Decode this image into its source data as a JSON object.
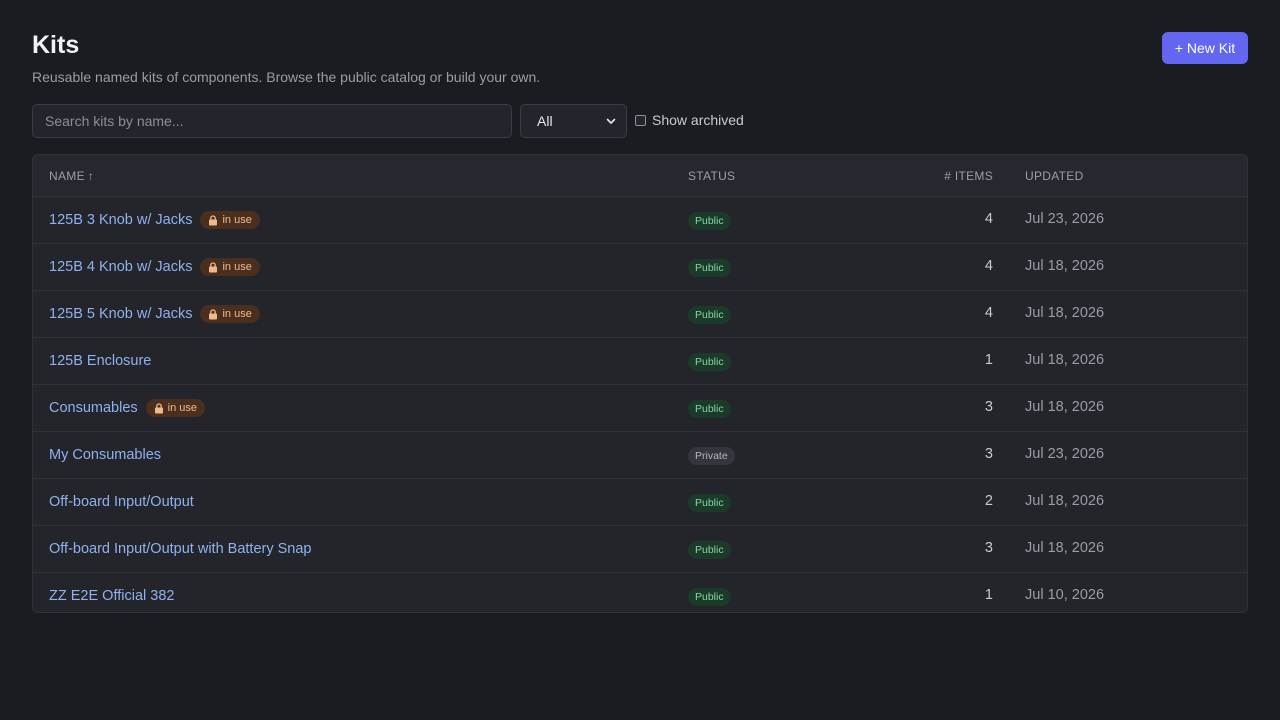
{
  "header": {
    "title": "Kits",
    "subtitle": "Reusable named kits of components. Browse the public catalog or build your own.",
    "new_button": "+ New Kit"
  },
  "filters": {
    "search_placeholder": "Search kits by name...",
    "select_value": "All",
    "show_archived_label": "Show archived",
    "show_archived_checked": false
  },
  "table": {
    "columns": {
      "name": "NAME",
      "sort_indicator": "↑",
      "status": "STATUS",
      "items": "# ITEMS",
      "updated": "UPDATED"
    },
    "rows": [
      {
        "name": "125B 3 Knob w/ Jacks",
        "in_use": "in use",
        "status": "Public",
        "items": "4",
        "updated": "Jul 23, 2026"
      },
      {
        "name": "125B 4 Knob w/ Jacks",
        "in_use": "in use",
        "status": "Public",
        "items": "4",
        "updated": "Jul 18, 2026"
      },
      {
        "name": "125B 5 Knob w/ Jacks",
        "in_use": "in use",
        "status": "Public",
        "items": "4",
        "updated": "Jul 18, 2026"
      },
      {
        "name": "125B Enclosure",
        "in_use": null,
        "status": "Public",
        "items": "1",
        "updated": "Jul 18, 2026"
      },
      {
        "name": "Consumables",
        "in_use": "in use",
        "status": "Public",
        "items": "3",
        "updated": "Jul 18, 2026"
      },
      {
        "name": "My Consumables",
        "in_use": null,
        "status": "Private",
        "items": "3",
        "updated": "Jul 23, 2026"
      },
      {
        "name": "Off-board Input/Output",
        "in_use": null,
        "status": "Public",
        "items": "2",
        "updated": "Jul 18, 2026"
      },
      {
        "name": "Off-board Input/Output with Battery Snap",
        "in_use": null,
        "status": "Public",
        "items": "3",
        "updated": "Jul 18, 2026"
      },
      {
        "name": "ZZ E2E Official 382",
        "in_use": null,
        "status": "Public",
        "items": "1",
        "updated": "Jul 10, 2026"
      }
    ]
  },
  "colors": {
    "accent": "#6366f1",
    "link": "#8fb1f0",
    "public_badge": "#1b3a2a",
    "private_badge": "#34363d",
    "in_use_badge": "#4a2f1f"
  },
  "icons": {
    "lock": "lock-icon",
    "sort": "arrow-up-icon",
    "select": "chevron-down-icon"
  }
}
